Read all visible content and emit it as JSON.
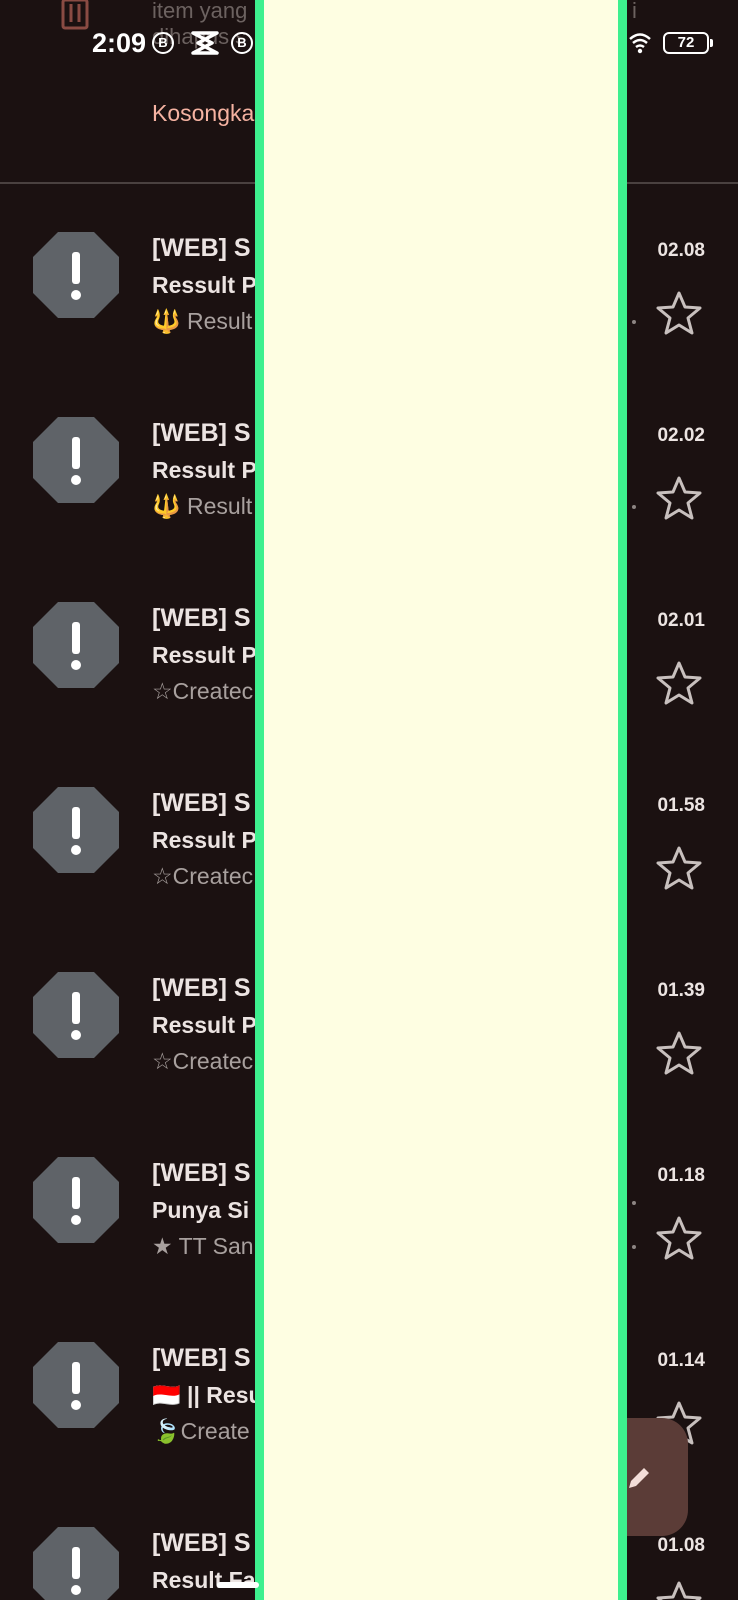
{
  "status_bar": {
    "time": "2:09",
    "badge_b": "B",
    "battery": "72",
    "icons": [
      "b-circle-icon",
      "capcut-icon",
      "b-circle-icon",
      "wifi-icon",
      "battery-icon"
    ]
  },
  "trash_banner": {
    "line1": "item yang",
    "line2": "dihapus s",
    "line1_right": "i",
    "empty_link": "Kosongka"
  },
  "emails": [
    {
      "sender": "[WEB] S",
      "subject": "Ressult P",
      "snippet_icon": "trident",
      "snippet": "Result",
      "time": "02.08"
    },
    {
      "sender": "[WEB] S",
      "subject": "Ressult P",
      "snippet_icon": "trident",
      "snippet": "Result",
      "time": "02.02"
    },
    {
      "sender": "[WEB] S",
      "subject": "Ressult P",
      "snippet_icon": "",
      "snippet": "☆Createc",
      "time": "02.01"
    },
    {
      "sender": "[WEB] S",
      "subject": "Ressult P",
      "snippet_icon": "",
      "snippet": "☆Createc",
      "time": "01.58"
    },
    {
      "sender": "[WEB] S",
      "subject": "Ressult P",
      "snippet_icon": "",
      "snippet": "☆Createc",
      "time": "01.39"
    },
    {
      "sender": "[WEB] S",
      "subject": "Punya Si",
      "snippet_icon": "",
      "snippet": "★ TT San",
      "time": "01.18"
    },
    {
      "sender": "[WEB] S",
      "subject": "🇮🇩 || Resu",
      "snippet_icon": "",
      "snippet": "🍃Create",
      "time": "01.14"
    },
    {
      "sender": "[WEB] S",
      "subject": "Result Fa",
      "snippet_icon": "",
      "snippet": "",
      "time": "01.08"
    }
  ],
  "colors": {
    "background": "#1b1111",
    "overlay": "#fefee2",
    "overlay_border": "#3df08e",
    "link": "#f6b3a2",
    "avatar": "#5f6368",
    "fab": "#5b3c37"
  }
}
